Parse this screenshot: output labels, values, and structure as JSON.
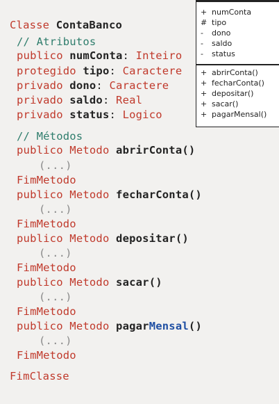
{
  "code": {
    "class_kw": "Classe",
    "class_name": "ContaBanco",
    "attr_comment": "// Atributos",
    "attributes": [
      {
        "vis": "publico",
        "name": "numConta",
        "type": "Inteiro"
      },
      {
        "vis": "protegido",
        "name": "tipo",
        "type": "Caractere"
      },
      {
        "vis": "privado",
        "name": "dono",
        "type": "Caractere"
      },
      {
        "vis": "privado",
        "name": "saldo",
        "type": "Real"
      },
      {
        "vis": "privado",
        "name": "status",
        "type": "Logico"
      }
    ],
    "method_comment": "// Métodos",
    "method_vis": "publico",
    "method_kw": "Metodo",
    "methods": [
      {
        "name": "abrirConta()"
      },
      {
        "name": "fecharConta()"
      },
      {
        "name": "depositar()"
      },
      {
        "name": "sacar()"
      },
      {
        "name_a": "pagar",
        "name_b": "Mensal",
        "name_c": "()"
      }
    ],
    "ellipsis": "(...)",
    "end_method": "FimMetodo",
    "end_class": "FimClasse"
  },
  "uml": {
    "attributes": [
      {
        "sym": "+",
        "name": "numConta"
      },
      {
        "sym": "#",
        "name": "tipo"
      },
      {
        "sym": "-",
        "name": "dono"
      },
      {
        "sym": "-",
        "name": "saldo"
      },
      {
        "sym": "-",
        "name": "status"
      }
    ],
    "methods": [
      {
        "sym": "+",
        "name": "abrirConta()"
      },
      {
        "sym": "+",
        "name": "fecharConta()"
      },
      {
        "sym": "+",
        "name": "depositar()"
      },
      {
        "sym": "+",
        "name": "sacar()"
      },
      {
        "sym": "+",
        "name": "pagarMensal()"
      }
    ]
  }
}
